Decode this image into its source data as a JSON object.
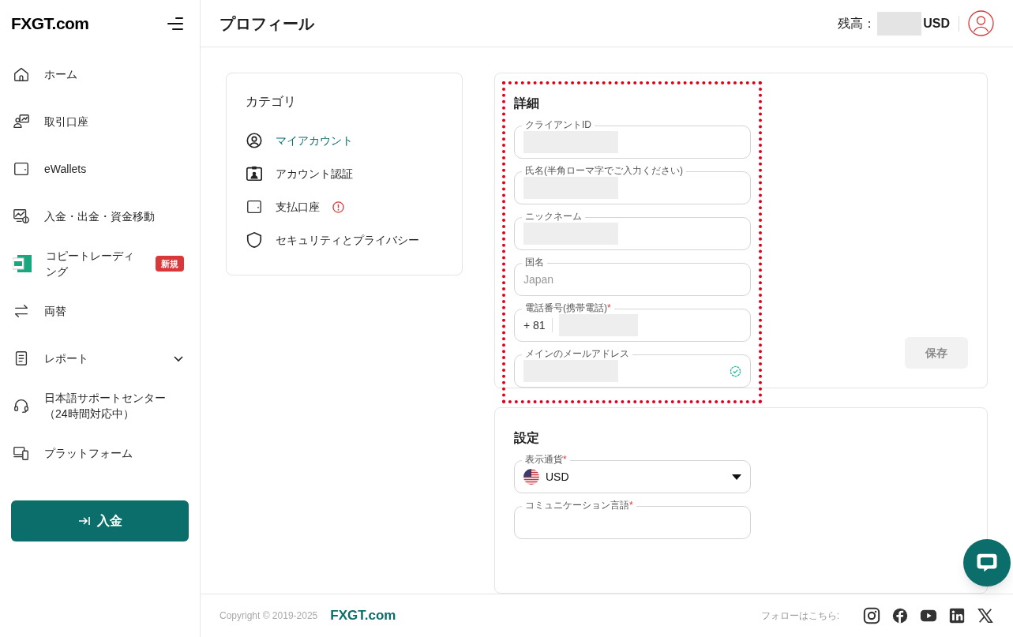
{
  "logo": "FXGT.com",
  "sidebar": {
    "items": [
      {
        "label": "ホーム"
      },
      {
        "label": "取引口座"
      },
      {
        "label": "eWallets"
      },
      {
        "label": "入金・出金・資金移動"
      },
      {
        "label": "コピートレーディング",
        "badge": "新規"
      },
      {
        "label": "両替"
      },
      {
        "label": "レポート",
        "expandable": true
      },
      {
        "label": "日本語サポートセンター（24時間対応中）"
      },
      {
        "label": "プラットフォーム"
      }
    ],
    "deposit_button": "入金"
  },
  "header": {
    "title": "プロフィール",
    "balance_label": "残高：",
    "balance_currency": "USD"
  },
  "category": {
    "title": "カテゴリ",
    "items": [
      {
        "label": "マイアカウント",
        "selected": true
      },
      {
        "label": "アカウント認証",
        "selected": false
      },
      {
        "label": "支払口座",
        "selected": false,
        "warning": true
      },
      {
        "label": "セキュリティとプライバシー",
        "selected": false
      }
    ]
  },
  "details": {
    "title": "詳細",
    "highlighted": true,
    "fields": [
      {
        "label": "クライアントID",
        "redacted": true
      },
      {
        "label": "氏名(半角ローマ字でご入力ください)",
        "redacted": true
      },
      {
        "label": "ニックネーム",
        "redacted": true
      },
      {
        "label": "国名",
        "value": "Japan",
        "disabled": true
      },
      {
        "label": "電話番号(携帯電話)",
        "required_mark": "*",
        "prefix": "+ 81",
        "redacted": true
      },
      {
        "label": "メインのメールアドレス",
        "redacted": true,
        "verified": true
      }
    ],
    "save_button": {
      "label": "保存",
      "disabled": true
    }
  },
  "settings": {
    "title": "設定",
    "fields": [
      {
        "label": "表示通貨",
        "required_mark": "*",
        "value": "USD",
        "dropdown": true
      },
      {
        "label": "コミュニケーション言語",
        "required_mark": "*"
      }
    ]
  },
  "footer": {
    "copyright": "Copyright © 2019-2025",
    "brand": "FXGT.com",
    "follow": "フォローはこちら:"
  }
}
